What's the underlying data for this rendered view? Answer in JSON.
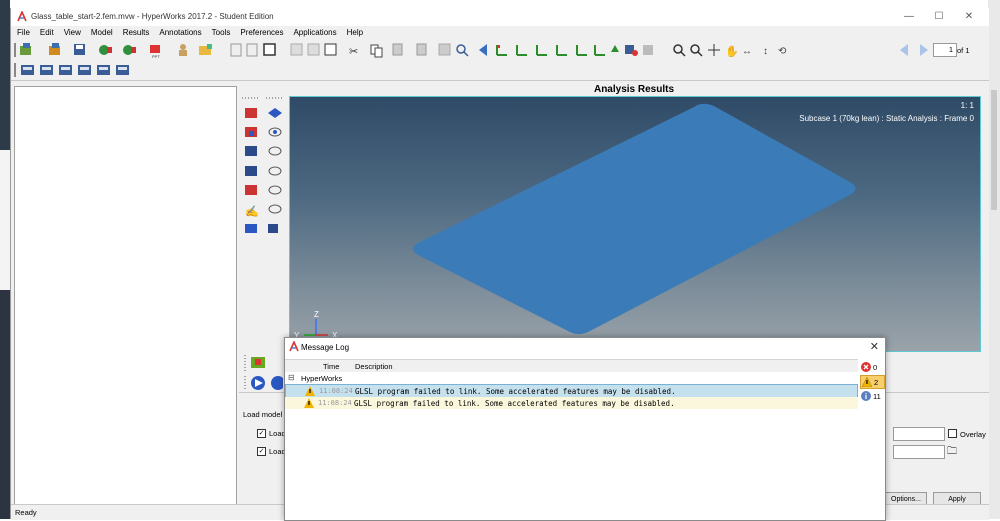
{
  "window": {
    "title": "Glass_table_start-2.fem.mvw - HyperWorks 2017.2 - Student Edition",
    "minimize_glyph": "—",
    "maximize_glyph": "☐",
    "close_glyph": "✕"
  },
  "menu": [
    "File",
    "Edit",
    "View",
    "Model",
    "Results",
    "Annotations",
    "Tools",
    "Preferences",
    "Applications",
    "Help"
  ],
  "toolbar": {
    "page_value": "1",
    "page_total": "of 1"
  },
  "graphics": {
    "title": "Analysis Results",
    "window_ratio": "1: 1",
    "subcase_label": "Subcase 1 (70kg lean) : Static Analysis : Frame 0",
    "triad": {
      "x": "X",
      "y": "Y",
      "z": "Z"
    },
    "plate_color": "#3b7bb7"
  },
  "lower_panel": {
    "load_model_label": "Load model",
    "checkbox1_label": "Load",
    "checkbox2_label": "Load",
    "overlay_label": "Overlay",
    "options_button": "Options...",
    "apply_button": "Apply"
  },
  "status": {
    "text": "Ready"
  },
  "message_log": {
    "title": "Message Log",
    "close_glyph": "✕",
    "columns": {
      "time": "Time",
      "description": "Description"
    },
    "group": "HyperWorks",
    "rows": [
      {
        "time": "11:08:24",
        "description": "GLSL program failed to link.  Some accelerated features may be disabled.",
        "selected": true
      },
      {
        "time": "11:08:24",
        "description": "GLSL program failed to link.  Some accelerated features may be disabled.",
        "selected": false
      }
    ],
    "counts": {
      "errors": "0",
      "warnings": "2",
      "info": "11"
    }
  }
}
